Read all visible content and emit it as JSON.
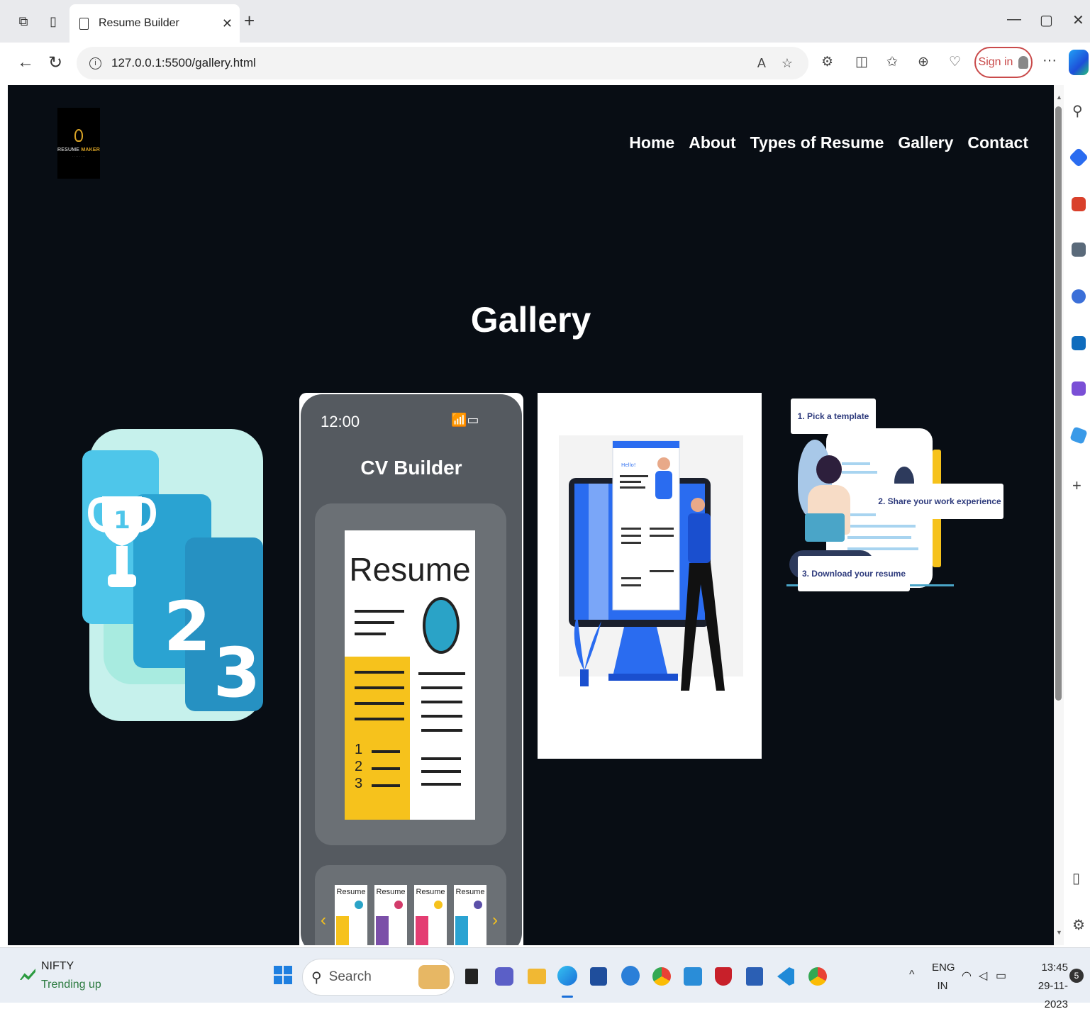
{
  "browser": {
    "tab_title": "Resume Builder",
    "url": "127.0.0.1:5500/gallery.html",
    "signin_label": "Sign in"
  },
  "site": {
    "logo_text_prefix": "RESUME ",
    "logo_text_accent": "MAKER",
    "nav": [
      {
        "label": "Home"
      },
      {
        "label": "About"
      },
      {
        "label": "Types of Resume"
      },
      {
        "label": "Gallery"
      },
      {
        "label": "Contact"
      }
    ],
    "heading": "Gallery"
  },
  "gallery": {
    "phone": {
      "time": "12:00",
      "app_title": "CV Builder",
      "card_title": "Resume",
      "list_numbers": [
        "1",
        "2",
        "3"
      ],
      "thumb_label": "Resume"
    },
    "steps": {
      "step1": "1. Pick a template",
      "step2": "2. Share your work experience",
      "step3": "3. Download your resume"
    },
    "monitor": {
      "hello": "Hello!"
    }
  },
  "taskbar": {
    "widget_title": "NIFTY",
    "widget_sub": "Trending up",
    "search_label": "Search",
    "lang_top": "ENG",
    "lang_bottom": "IN",
    "time": "13:45",
    "date": "29-11-2023",
    "notif_count": "5"
  },
  "colors": {
    "page_bg": "#080d14",
    "accent_gold": "#d9a326",
    "signin_red": "#c94a4a"
  }
}
